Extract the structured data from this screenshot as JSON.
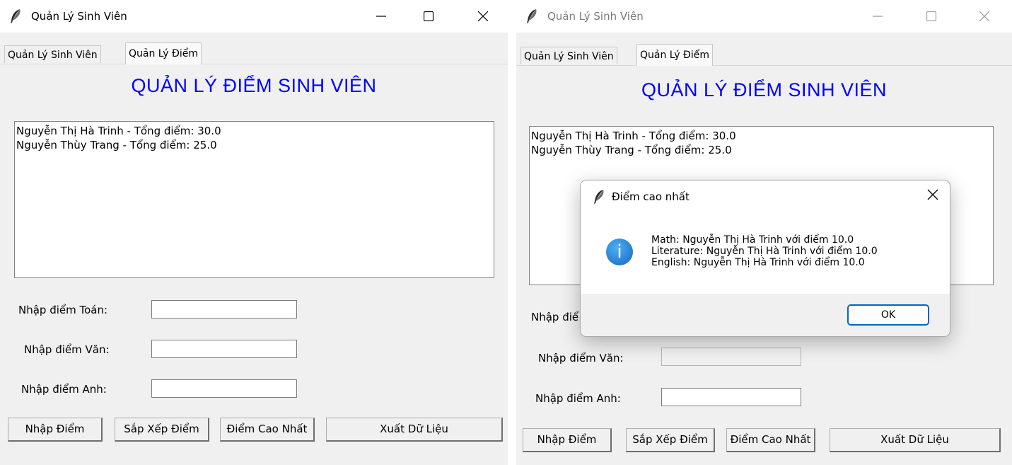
{
  "left_window": {
    "title": "Quản Lý Sinh Viên",
    "tabs": [
      {
        "label": "Quản Lý Sinh Viên",
        "selected": false
      },
      {
        "label": "Quản Lý Điểm",
        "selected": true
      }
    ],
    "header": "QUẢN LÝ ĐIỂM SINH VIÊN",
    "list_items": [
      "Nguyễn Thị Hà Trinh - Tổng điểm: 30.0",
      "Nguyễn Thùy Trang - Tổng điểm: 25.0"
    ],
    "form": {
      "math_label": "Nhập điểm Toán:",
      "lit_label": "Nhập điểm Văn:",
      "eng_label": "Nhập điểm Anh:",
      "math_value": "",
      "lit_value": "",
      "eng_value": ""
    },
    "buttons": {
      "enter": "Nhập Điểm",
      "sort": "Sắp Xếp Điểm",
      "highest": "Điểm Cao Nhất",
      "export": "Xuất Dữ Liệu"
    }
  },
  "right_window": {
    "title": "Quản Lý Sinh Viên",
    "tabs": [
      {
        "label": "Quản Lý Sinh Viên",
        "selected": false
      },
      {
        "label": "Quản Lý Điểm",
        "selected": true
      }
    ],
    "header": "QUẢN LÝ ĐIỂM SINH VIÊN",
    "list_items": [
      "Nguyễn Thị Hà Trinh - Tổng điểm: 30.0",
      "Nguyễn Thùy Trang - Tổng điểm: 25.0"
    ],
    "form": {
      "math_label_partial": "Nhập điể",
      "lit_label": "Nhập điểm Văn:",
      "eng_label": "Nhập điểm Anh:"
    },
    "buttons": {
      "enter": "Nhập Điểm",
      "sort": "Sắp Xếp Điểm",
      "highest": "Điểm Cao Nhất",
      "export": "Xuất Dữ Liệu"
    }
  },
  "dialog": {
    "title": "Điểm cao nhất",
    "icon": "info-icon",
    "lines": [
      "Math: Nguyễn Thị Hà Trinh với điểm 10.0",
      "Literature: Nguyễn Thị Hà Trinh với điểm 10.0",
      "English: Nguyễn Thị Hà Trinh với điểm 10.0"
    ],
    "ok_label": "OK"
  },
  "colors": {
    "header_blue": "#0000ff",
    "window_bg": "#f0f0f0",
    "accent": "#0067c0"
  }
}
